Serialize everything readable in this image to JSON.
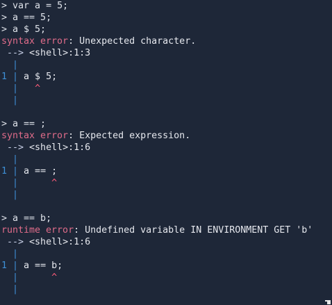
{
  "lines": [
    {
      "kind": "input",
      "prompt": ">",
      "text": "var a = 5;"
    },
    {
      "kind": "input",
      "prompt": ">",
      "text": "a == 5;"
    },
    {
      "kind": "input",
      "prompt": ">",
      "text": "a $ 5;"
    },
    {
      "kind": "error",
      "label": "syntax error",
      "message": ": Unexpected character."
    },
    {
      "kind": "location",
      "arrow": " -->",
      "text": "<shell>:1:3"
    },
    {
      "kind": "gutter",
      "bar": "  |"
    },
    {
      "kind": "source",
      "num": "1",
      "bar": " |",
      "code": "a $ 5;"
    },
    {
      "kind": "caret",
      "bar": "  |",
      "pad": "   ",
      "caret": "^"
    },
    {
      "kind": "gutter",
      "bar": "  |"
    },
    {
      "kind": "blank"
    },
    {
      "kind": "input",
      "prompt": ">",
      "text": "a == ;"
    },
    {
      "kind": "error",
      "label": "syntax error",
      "message": ": Expected expression."
    },
    {
      "kind": "location",
      "arrow": " -->",
      "text": "<shell>:1:6"
    },
    {
      "kind": "gutter",
      "bar": "  |"
    },
    {
      "kind": "source",
      "num": "1",
      "bar": " |",
      "code": "a == ;"
    },
    {
      "kind": "caret",
      "bar": "  |",
      "pad": "      ",
      "caret": "^"
    },
    {
      "kind": "gutter",
      "bar": "  |"
    },
    {
      "kind": "blank"
    },
    {
      "kind": "input",
      "prompt": ">",
      "text": "a == b;"
    },
    {
      "kind": "error",
      "label": "runtime error",
      "message": ": Undefined variable IN ENVIRONMENT GET 'b'"
    },
    {
      "kind": "location",
      "arrow": " -->",
      "text": "<shell>:1:6"
    },
    {
      "kind": "gutter",
      "bar": "  |"
    },
    {
      "kind": "source",
      "num": "1",
      "bar": " |",
      "code": "a == b;"
    },
    {
      "kind": "caret",
      "bar": "  |",
      "pad": "      ",
      "caret": "^"
    },
    {
      "kind": "gutter",
      "bar": "  |"
    }
  ]
}
